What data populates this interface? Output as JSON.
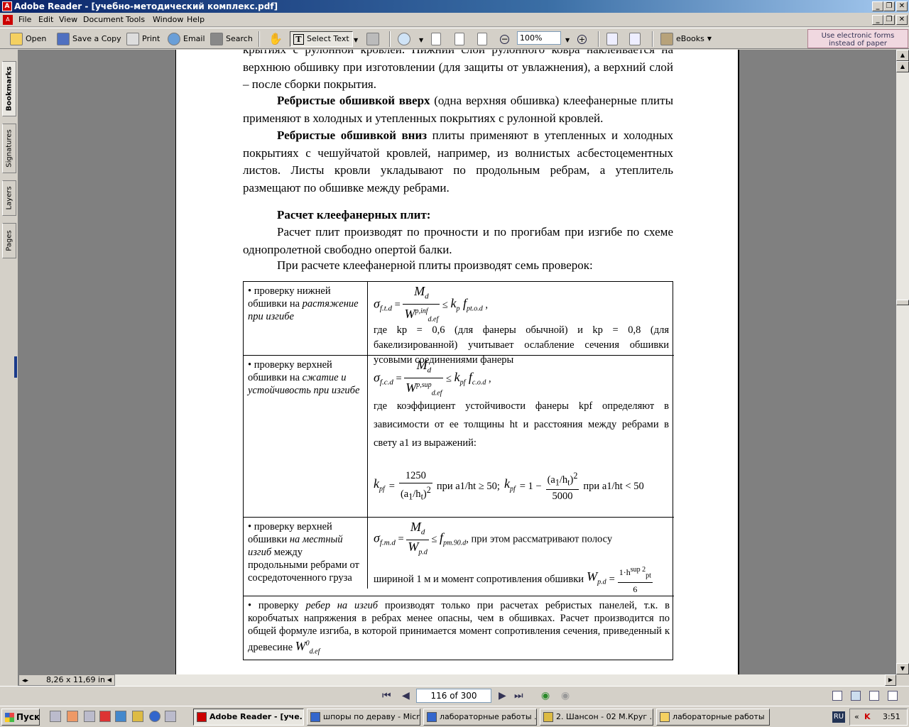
{
  "window": {
    "title": "Adobe Reader - [учебно-методический комплекс.pdf]",
    "title_icon": "acrobat-icon"
  },
  "menu": [
    "File",
    "Edit",
    "View",
    "Document",
    "Tools",
    "Window",
    "Help"
  ],
  "toolbar": {
    "open": "Open",
    "save_copy": "Save a Copy",
    "print": "Print",
    "email": "Email",
    "search": "Search",
    "select_text": "Select Text",
    "zoom": "100%",
    "ebooks": "eBooks",
    "forms_line1": "Use electronic forms",
    "forms_line2": "instead of paper"
  },
  "nav_tabs": [
    "Bookmarks",
    "Signatures",
    "Layers",
    "Pages"
  ],
  "document": {
    "p0": "крытиях с рулонной кровлей. Нижний слой рулонного ковра наклеивается на верхнюю обшивку при изготовлении (для защиты от увлажнения), а верхний слой – после сборки покрытия.",
    "p1_bold": "Ребристые обшивкой вверх",
    "p1_rest": " (одна верхняя обшивка) клеефанерные плиты применяют в холодных и утепленных покрытиях с рулонной кровлей.",
    "p2_bold": "Ребристые обшивкой вниз",
    "p2_rest": " плиты применяют в утепленных и холодных покрытиях с чешуйчатой кровлей, например, из волнистых асбестоцементных листов. Листы кровли укладывают по продольным ребрам, а утеплитель размещают по обшивке между ребрами.",
    "heading": "Расчет клеефанерных плит:",
    "p3": "Расчет плит производят по прочности и по прогибам при изгибе по схеме однопролетной свободно опертой балки.",
    "p4": "При расчете клеефанерной плиты производят семь проверок:",
    "rows": [
      {
        "left_pre": "• проверку нижней обшивки на ",
        "left_it": "растяжение при изгибе",
        "right_text": "где  kp = 0,6  (для фанеры обычной) и  kp = 0,8 (для бакелизированной) учитывает ослабление сечения обшивки усовыми соединениями фанеры"
      },
      {
        "left_pre": "•  проверку верхней обшивки на ",
        "left_it": "сжатие и устойчивость при изгибе",
        "right_text": "где коэффициент устойчивости фанеры kpf определяют в зависимости от ее толщины ht и расстояния между ребрами в свету a1 из выражений:",
        "cond1": "при a1/ht ≥ 50;",
        "cond2": "при a1/ht < 50"
      },
      {
        "left_pre": "• проверку верхней обшивки ",
        "left_it": "на местный изгиб",
        "left_post": " между продольными ребрами от сосредоточенного груза",
        "right_text1": ", при этом рассматривают полосу",
        "right_text2": "шириной 1 м и момент сопротивления обшивки"
      }
    ],
    "last_pre": "• проверку ",
    "last_it": "ребер на изгиб",
    "last_rest": " производят только при расчетах ребристых панелей, т.к. в коробчатых напряжения в ребрах менее опасны, чем в обшивках. Расчет производится по общей формуле изгиба, в которой принимается момент сопротивления сечения, приведенный к древесине"
  },
  "status": {
    "page_size": "8,26 x 11,69 in",
    "page_indicator": "116 of 300"
  },
  "taskbar": {
    "start": "Пуск",
    "tasks": [
      "Adobe Reader - [уче...",
      "шпоры по дераву - Micr...",
      "лабораторные работы ...",
      "2. Шансон - 02 М.Круг ...",
      "лабораторные работы"
    ],
    "lang": "RU",
    "clock": "3:51"
  }
}
